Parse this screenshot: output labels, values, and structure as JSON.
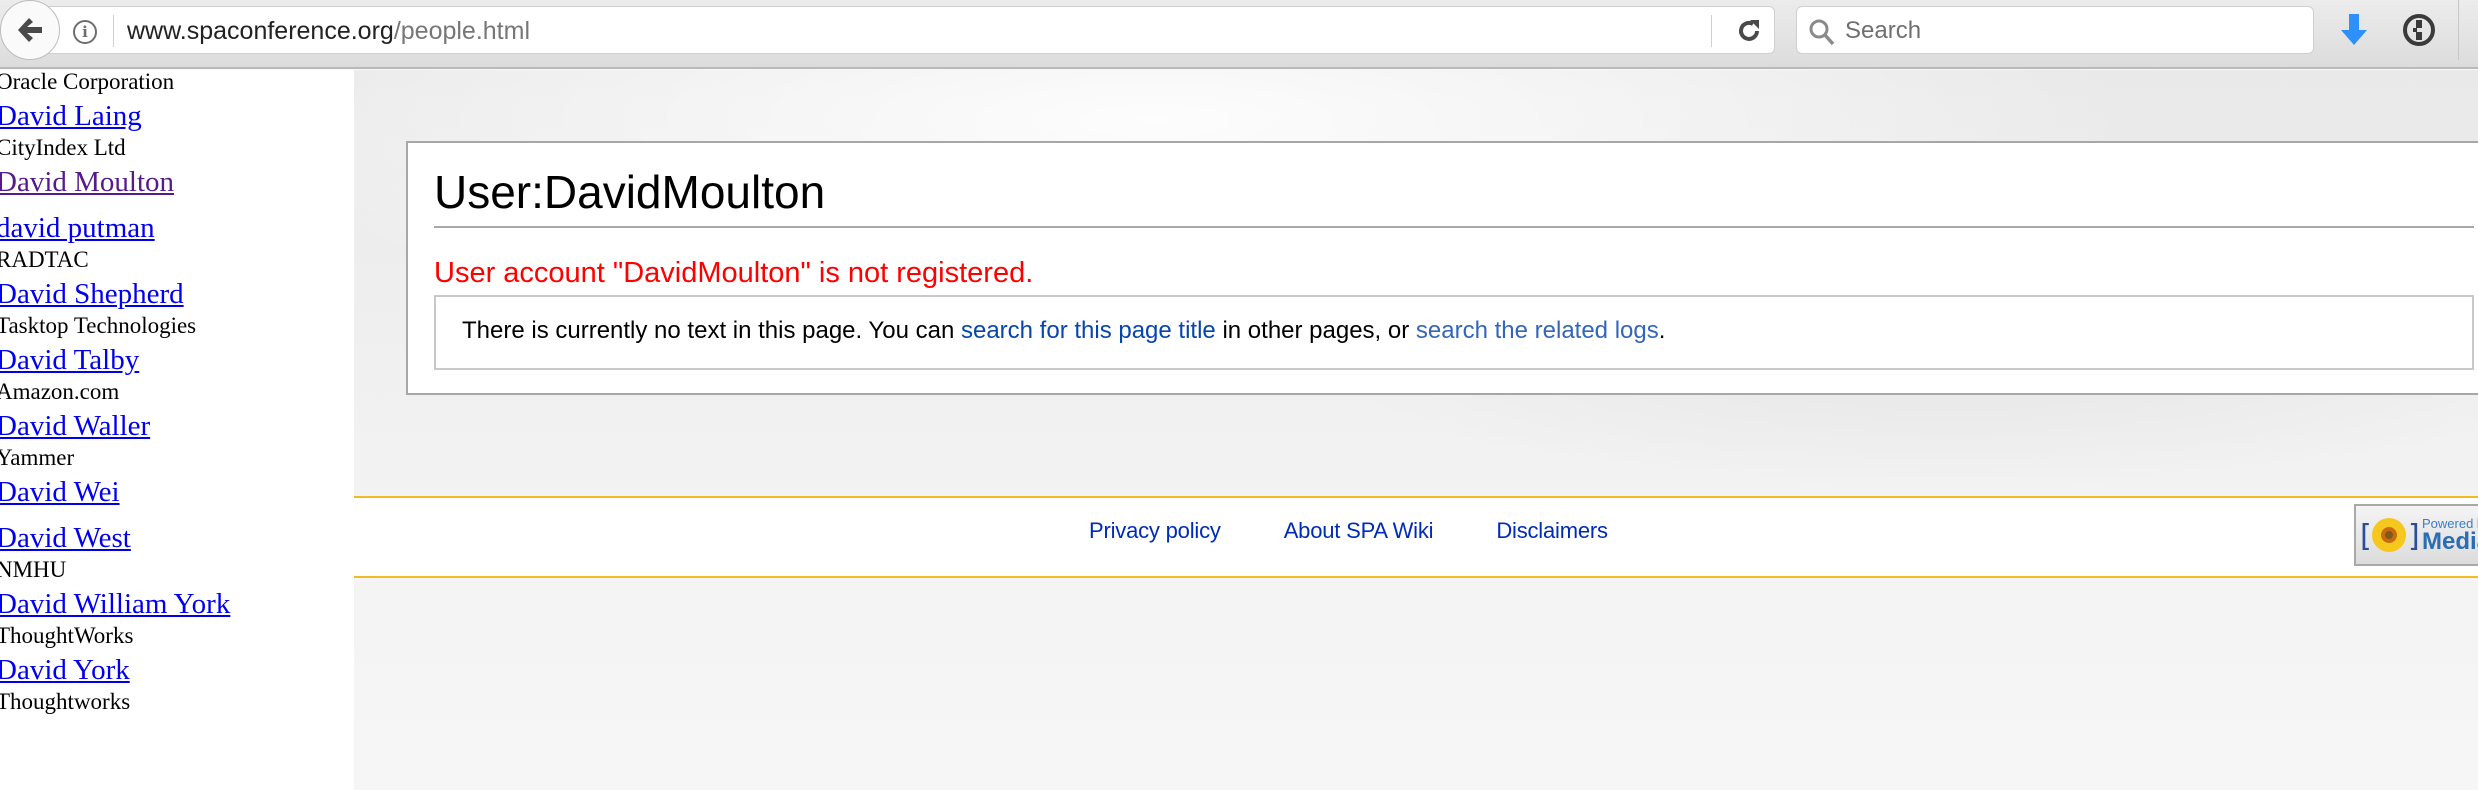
{
  "browser": {
    "url_domain": "www.spaconference.org",
    "url_path": "/people.html",
    "search_placeholder": "Search"
  },
  "people": [
    {
      "name": "",
      "org": "Oracle Corporation",
      "visited": false
    },
    {
      "name": "David Laing",
      "org": "CityIndex Ltd",
      "visited": false
    },
    {
      "name": "David Moulton",
      "org": "",
      "visited": true
    },
    {
      "name": "david putman",
      "org": "RADTAC",
      "visited": false
    },
    {
      "name": "David Shepherd",
      "org": "Tasktop Technologies",
      "visited": false
    },
    {
      "name": "David Talby",
      "org": "Amazon.com",
      "visited": false
    },
    {
      "name": "David Waller",
      "org": "Yammer",
      "visited": false
    },
    {
      "name": "David Wei",
      "org": "",
      "visited": false
    },
    {
      "name": "David West",
      "org": "NMHU",
      "visited": false
    },
    {
      "name": "David William York",
      "org": "ThoughtWorks",
      "visited": false
    },
    {
      "name": "David York",
      "org": "Thoughtworks",
      "visited": false
    }
  ],
  "wiki": {
    "page_title": "User:DavidMoulton",
    "error_message": "User account \"DavidMoulton\" is not registered.",
    "notice": {
      "prefix": "There is currently no text in this page. You can ",
      "link1": "search for this page title",
      "middle": " in other pages, or ",
      "link2": "search the related logs",
      "suffix": "."
    }
  },
  "footer": {
    "links": [
      "Privacy policy",
      "About SPA Wiki",
      "Disclaimers"
    ],
    "badge_small": "Powered by",
    "badge_big": "MediaWiki"
  },
  "colors": {
    "link": "#0000ee",
    "visited_link": "#551a8b",
    "error": "#ff0000",
    "wiki_link": "#0645ad",
    "footer_rule": "#f0bc25"
  }
}
